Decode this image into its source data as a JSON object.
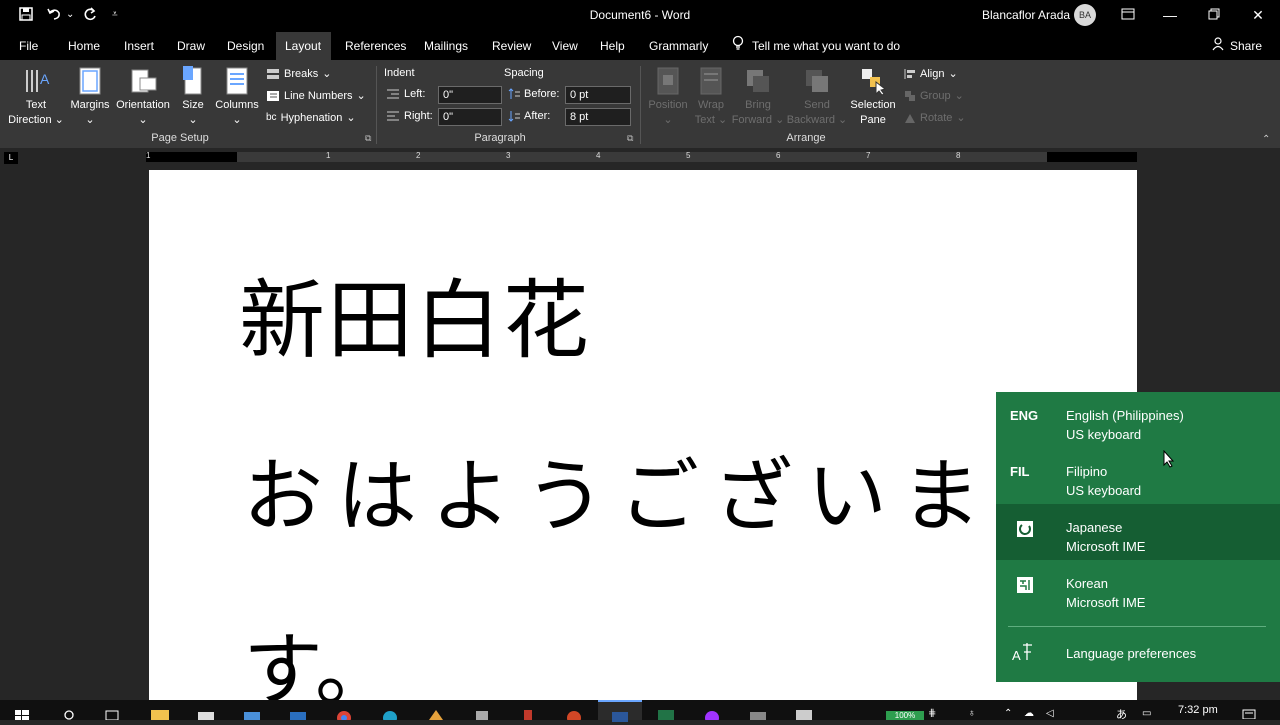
{
  "window": {
    "title": "Document6  -  Word",
    "user": "Blancaflor Arada",
    "user_initials": "BA"
  },
  "menu": {
    "tabs": [
      "File",
      "Home",
      "Insert",
      "Draw",
      "Design",
      "Layout",
      "References",
      "Mailings",
      "Review",
      "View",
      "Help",
      "Grammarly"
    ],
    "active": "Layout",
    "tell_me": "Tell me what you want to do",
    "share": "Share"
  },
  "ribbon": {
    "page_setup": {
      "text_direction_1": "Text",
      "text_direction_2": "Direction",
      "margins": "Margins",
      "orientation": "Orientation",
      "size": "Size",
      "columns": "Columns",
      "breaks": "Breaks",
      "line_numbers": "Line Numbers",
      "hyphenation": "Hyphenation",
      "label": "Page Setup"
    },
    "paragraph": {
      "indent": "Indent",
      "spacing": "Spacing",
      "left_label": "Left:",
      "left_value": "0\"",
      "right_label": "Right:",
      "right_value": "0\"",
      "before_label": "Before:",
      "before_value": "0 pt",
      "after_label": "After:",
      "after_value": "8 pt",
      "label": "Paragraph"
    },
    "arrange": {
      "position": "Position",
      "wrap_1": "Wrap",
      "wrap_2": "Text",
      "bring_1": "Bring",
      "bring_2": "Forward",
      "send_1": "Send",
      "send_2": "Backward",
      "selection_1": "Selection",
      "selection_2": "Pane",
      "align": "Align",
      "group": "Group",
      "rotate": "Rotate",
      "label": "Arrange"
    }
  },
  "ruler": {
    "numbers": [
      "1",
      "1",
      "2",
      "3",
      "4",
      "5",
      "6",
      "7",
      "8"
    ]
  },
  "document": {
    "line1": "新田白花",
    "line2": "おはようございま",
    "line3": "す。"
  },
  "language_menu": {
    "items": [
      {
        "code": "ENG",
        "name": "English (Philippines)",
        "sub": "US keyboard"
      },
      {
        "code": "FIL",
        "name": "Filipino",
        "sub": "US keyboard"
      },
      {
        "code": "",
        "name": "Japanese",
        "sub": "Microsoft IME"
      },
      {
        "code": "",
        "name": "Korean",
        "sub": "Microsoft IME"
      }
    ],
    "preferences": "Language preferences"
  },
  "taskbar": {
    "time": "7:32 pm",
    "battery": "100%"
  },
  "colors": {
    "lang_panel": "#1f7a44",
    "lang_selected": "#155e33",
    "ribbon": "#383838",
    "titlebar": "#000000"
  }
}
